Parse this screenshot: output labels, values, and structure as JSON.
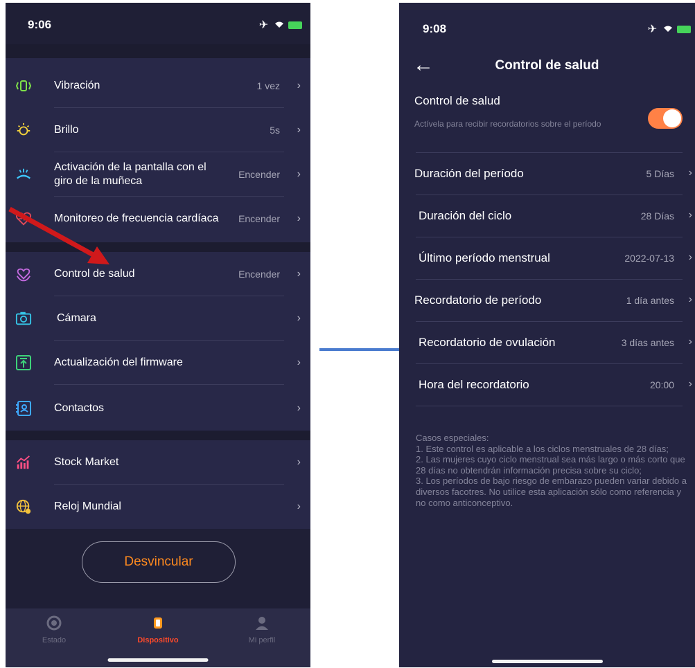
{
  "left_screen": {
    "status_time": "9:06",
    "settings": [
      {
        "icon": "vibration-icon",
        "label": "Vibración",
        "value": "1 vez"
      },
      {
        "icon": "brightness-icon",
        "label": "Brillo",
        "value": "5s"
      },
      {
        "icon": "wrist-raise-icon",
        "label": "Activación de la pantalla con el giro de la muñeca",
        "value": "Encender"
      },
      {
        "icon": "heart-rate-icon",
        "label": "Monitoreo de frecuencia cardíaca",
        "value": "Encender"
      },
      {
        "icon": "health-heart-icon",
        "label": "Control de salud",
        "value": "Encender"
      },
      {
        "icon": "camera-icon",
        "label": "Cámara",
        "value": ""
      },
      {
        "icon": "firmware-update-icon",
        "label": "Actualización del firmware",
        "value": ""
      },
      {
        "icon": "contacts-icon",
        "label": "Contactos",
        "value": ""
      },
      {
        "icon": "stock-market-icon",
        "label": "Stock Market",
        "value": ""
      },
      {
        "icon": "world-clock-icon",
        "label": "Reloj Mundial",
        "value": ""
      }
    ],
    "unlink_button": "Desvincular",
    "tabs": [
      {
        "label": "Estado",
        "active": false
      },
      {
        "label": "Dispositivo",
        "active": true
      },
      {
        "label": "Mi perfil",
        "active": false
      }
    ]
  },
  "right_screen": {
    "status_time": "9:08",
    "nav_title": "Control de salud",
    "toggle_title": "Control de salud",
    "toggle_subtitle": "Actívela para recibir recordatorios sobre el período",
    "toggle_on": true,
    "rows": [
      {
        "label": "Duración del período",
        "value": "5 Días"
      },
      {
        "label": "Duración del ciclo",
        "value": "28 Días"
      },
      {
        "label": "Último período menstrual",
        "value": "2022-07-13"
      },
      {
        "label": "Recordatorio de período",
        "value": "1 día antes"
      },
      {
        "label": "Recordatorio de ovulación",
        "value": "3 días antes"
      },
      {
        "label": "Hora del recordatorio",
        "value": "20:00"
      }
    ],
    "notes": "Casos especiales:\n1. Este control es aplicable a los ciclos menstruales de 28 días;\n2. Las mujeres cuyo ciclo menstrual sea más largo o más corto que 28 días no obtendrán información precisa sobre su ciclo;\n3. Los períodos de bajo riesgo de embarazo pueden variar debido a diversos facotres. No utilice esta aplicación sólo como referencia y no como anticonceptivo."
  },
  "colors": {
    "accent_orange": "#ff8a1f",
    "toggle_orange": "#ff8146",
    "annotation_red": "#d0191b",
    "annotation_blue": "#4a7ccf",
    "vibration_green": "#7ee04a",
    "brightness_yellow": "#f3d23c",
    "wrist_blue": "#3ec8ff",
    "heart_red": "#e14a5a",
    "health_purple": "#c46ae0",
    "camera_cyan": "#36c6e8",
    "firmware_green": "#3ed27a",
    "contacts_blue": "#3ea9ff",
    "stock_pink": "#ff4f84",
    "world_yellow": "#f3c23c"
  }
}
